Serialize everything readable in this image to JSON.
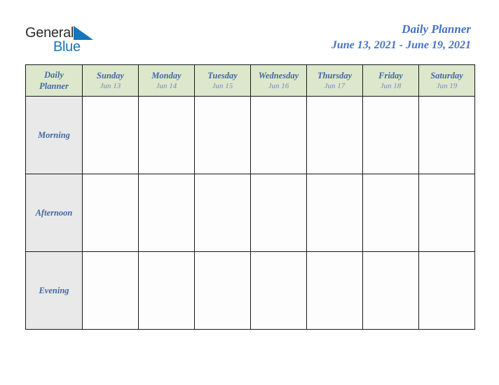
{
  "brand": {
    "name_dark": "General",
    "name_blue": "Blue",
    "triangle_icon": "triangle-icon",
    "dark_color": "#2b2b2b",
    "blue_color": "#1476bb"
  },
  "header": {
    "title": "Daily Planner",
    "date_range": "June 13, 2021 - June 19, 2021",
    "title_color": "#4571c4"
  },
  "colors": {
    "header_row_bg": "#dde7cb",
    "row_label_bg": "#e9e9e9",
    "cell_bg": "#fdfdfd",
    "border": "#16191c",
    "day_name_text": "#41699f",
    "day_date_text": "#6b8fb8"
  },
  "table": {
    "corner": {
      "line1": "Daily",
      "line2": "Planner"
    },
    "columns": [
      {
        "day": "Sunday",
        "date": "Jun 13"
      },
      {
        "day": "Monday",
        "date": "Jun 14"
      },
      {
        "day": "Tuesday",
        "date": "Jun 15"
      },
      {
        "day": "Wednesday",
        "date": "Jun 16"
      },
      {
        "day": "Thursday",
        "date": "Jun 17"
      },
      {
        "day": "Friday",
        "date": "Jun 18"
      },
      {
        "day": "Saturday",
        "date": "Jun 19"
      }
    ],
    "rows": [
      {
        "label": "Morning",
        "cells": [
          "",
          "",
          "",
          "",
          "",
          "",
          ""
        ]
      },
      {
        "label": "Afternoon",
        "cells": [
          "",
          "",
          "",
          "",
          "",
          "",
          ""
        ]
      },
      {
        "label": "Evening",
        "cells": [
          "",
          "",
          "",
          "",
          "",
          "",
          ""
        ]
      }
    ]
  }
}
